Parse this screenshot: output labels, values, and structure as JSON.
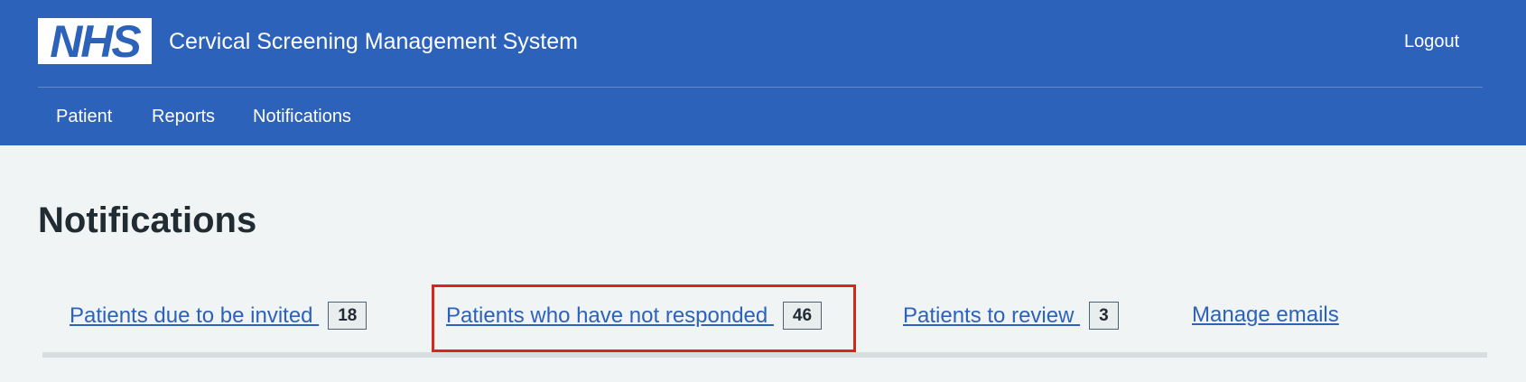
{
  "header": {
    "logo_text": "NHS",
    "service_name": "Cervical Screening Management System",
    "logout_label": "Logout",
    "nav": [
      {
        "label": "Patient"
      },
      {
        "label": "Reports"
      },
      {
        "label": "Notifications"
      }
    ]
  },
  "main": {
    "title": "Notifications",
    "tabs": [
      {
        "label": "Patients due to be invited ",
        "count": "18"
      },
      {
        "label": "Patients who have not responded ",
        "count": "46"
      },
      {
        "label": "Patients to review ",
        "count": "3"
      },
      {
        "label": "Manage emails"
      }
    ]
  },
  "colors": {
    "header_bg": "#2c62ba",
    "page_bg": "#f0f4f5",
    "link": "#2c62ba",
    "highlight": "#d5281b"
  }
}
